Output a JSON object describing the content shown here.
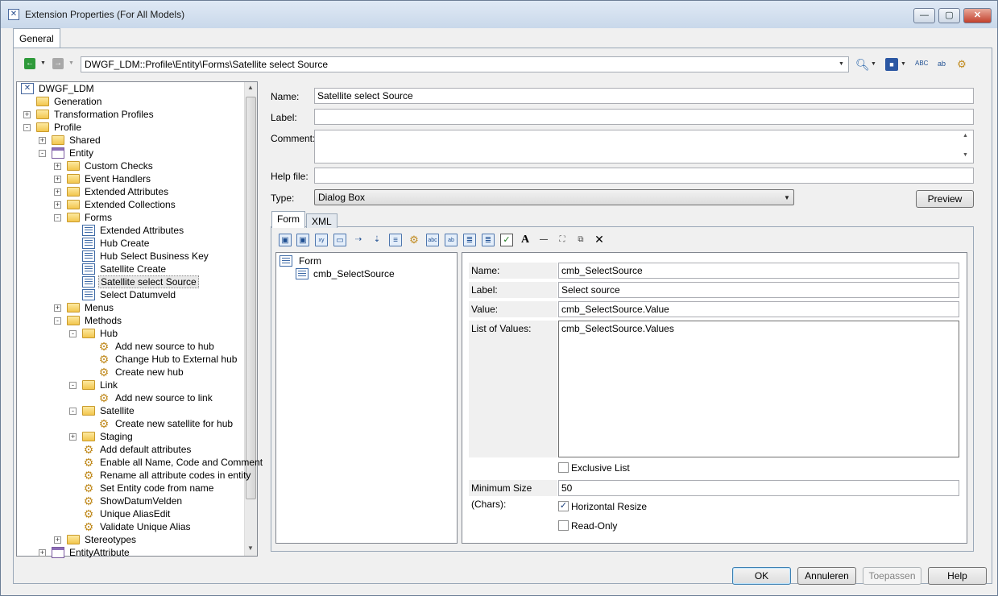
{
  "window": {
    "title": "Extension Properties (For All Models)",
    "controls": {
      "minimize": "—",
      "maximize": "▢",
      "close": "✕"
    }
  },
  "tabs": {
    "general": "General"
  },
  "toolbar": {
    "path": "DWGF_LDM::Profile\\Entity\\Forms\\Satellite select Source",
    "back_icon": "back-arrow-icon",
    "forward_icon": "forward-arrow-icon"
  },
  "tree": {
    "root": "DWGF_LDM",
    "generation": "Generation",
    "transformation_profiles": "Transformation Profiles",
    "profile": "Profile",
    "shared": "Shared",
    "entity": "Entity",
    "custom_checks": "Custom Checks",
    "event_handlers": "Event Handlers",
    "extended_attributes": "Extended Attributes",
    "extended_collections": "Extended Collections",
    "forms": "Forms",
    "form_items": [
      "Extended Attributes",
      "Hub Create",
      "Hub Select Business Key",
      "Satellite Create",
      "Satellite select Source",
      "Select Datumveld"
    ],
    "menus": "Menus",
    "methods": "Methods",
    "hub": "Hub",
    "hub_methods": [
      "Add new source to hub",
      "Change Hub to External hub",
      "Create new hub"
    ],
    "link": "Link",
    "link_methods": [
      "Add new source to link"
    ],
    "satellite": "Satellite",
    "satellite_methods": [
      "Create new satellite for hub"
    ],
    "staging": "Staging",
    "entity_methods": [
      "Add default attributes",
      "Enable all Name, Code and Comment",
      "Rename all attribute codes in entity",
      "Set Entity code from name",
      "ShowDatumVelden",
      "Unique AliasEdit",
      "Validate Unique Alias"
    ],
    "stereotypes": "Stereotypes",
    "entity_attribute": "EntityAttribute"
  },
  "props": {
    "name_label": "Name:",
    "name_value": "Satellite select Source",
    "label_label": "Label:",
    "label_value": "",
    "comment_label": "Comment:",
    "comment_value": "",
    "helpfile_label": "Help file:",
    "helpfile_value": "",
    "type_label": "Type:",
    "type_value": "Dialog Box",
    "preview_button": "Preview"
  },
  "inner_tabs": {
    "form": "Form",
    "xml": "XML"
  },
  "form_tree": {
    "root": "Form",
    "child": "cmb_SelectSource"
  },
  "control": {
    "name_label": "Name:",
    "name_value": "cmb_SelectSource",
    "label_label": "Label:",
    "label_value": "Select source",
    "value_label": "Value:",
    "value_value": "cmb_SelectSource.Value",
    "lov_label": "List of Values:",
    "lov_value": "cmb_SelectSource.Values",
    "exclusive_list": "Exclusive List",
    "exclusive_checked": false,
    "min_size_label": "Minimum Size (Chars):",
    "min_size_value": "50",
    "horizontal_resize": "Horizontal Resize",
    "horizontal_resize_checked": true,
    "read_only": "Read-Only",
    "read_only_checked": false
  },
  "buttons": {
    "ok": "OK",
    "cancel": "Annuleren",
    "apply": "Toepassen",
    "help": "Help"
  }
}
